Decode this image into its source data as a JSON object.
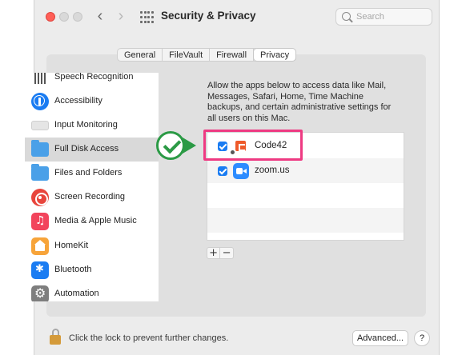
{
  "window": {
    "title": "Security & Privacy",
    "search_placeholder": "Search"
  },
  "tabs": [
    {
      "label": "General",
      "active": false
    },
    {
      "label": "FileVault",
      "active": false
    },
    {
      "label": "Firewall",
      "active": false
    },
    {
      "label": "Privacy",
      "active": true
    }
  ],
  "sidebar": {
    "items": [
      {
        "label": "Speech Recognition",
        "icon": "speech-recognition-icon"
      },
      {
        "label": "Accessibility",
        "icon": "accessibility-icon"
      },
      {
        "label": "Input Monitoring",
        "icon": "keyboard-icon"
      },
      {
        "label": "Full Disk Access",
        "icon": "folder-icon",
        "selected": true
      },
      {
        "label": "Files and Folders",
        "icon": "folder-icon"
      },
      {
        "label": "Screen Recording",
        "icon": "screen-recording-icon"
      },
      {
        "label": "Media & Apple Music",
        "icon": "music-icon"
      },
      {
        "label": "HomeKit",
        "icon": "home-icon"
      },
      {
        "label": "Bluetooth",
        "icon": "bluetooth-icon"
      },
      {
        "label": "Automation",
        "icon": "gear-icon"
      }
    ]
  },
  "main": {
    "description": "Allow the apps below to access data like Mail, Messages, Safari, Home, Time Machine backups, and certain administrative settings for all users on this Mac.",
    "apps": [
      {
        "name": "Code42",
        "checked": true,
        "icon": "code42-icon"
      },
      {
        "name": "zoom.us",
        "checked": true,
        "icon": "zoom-icon"
      }
    ],
    "add_label": "+",
    "remove_label": "−"
  },
  "footer": {
    "lock_text": "Click the lock to prevent further changes.",
    "advanced_label": "Advanced...",
    "help_label": "?"
  },
  "colors": {
    "highlight": "#ee3a82",
    "callout": "#2b9a45",
    "checkbox": "#1a7cf2"
  }
}
